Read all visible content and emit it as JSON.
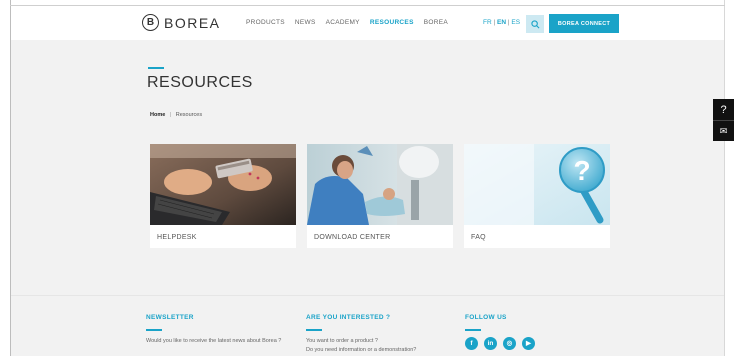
{
  "header": {
    "logo_mark": "B",
    "logo_text": "BOREA",
    "nav": [
      "PRODUCTS",
      "NEWS",
      "ACADEMY",
      "RESOURCES",
      "BOREA"
    ],
    "active_nav": "RESOURCES",
    "languages": {
      "fr": "FR",
      "en": "EN",
      "es": "ES",
      "sep": "|"
    },
    "current_language": "EN",
    "search_icon": "search-icon",
    "connect_label": "BOREA CONNECT"
  },
  "page": {
    "title": "RESOURCES",
    "breadcrumb": {
      "home": "Home",
      "sep": "|",
      "current": "Resources"
    }
  },
  "cards": [
    {
      "label": "HELPDESK",
      "image": "hands-laptop-credit-card-photo"
    },
    {
      "label": "DOWNLOAD CENTER",
      "image": "dentist-patient-photo"
    },
    {
      "label": "FAQ",
      "image": "question-mark-bubble-illustration"
    }
  ],
  "side_tools": {
    "help_icon": "?",
    "mail_icon": "✉"
  },
  "footer": {
    "newsletter": {
      "title": "NEWSLETTER",
      "text": "Would you like to receive the latest news about Borea ?"
    },
    "interested": {
      "title": "ARE YOU INTERESTED ?",
      "line1": "You want to order a product ?",
      "line2": "Do you need information or a demonstration?"
    },
    "follow": {
      "title": "FOLLOW US",
      "networks": [
        "f",
        "in",
        "◎",
        "▶"
      ]
    }
  },
  "colors": {
    "accent": "#1aa3c8",
    "background": "#f2f2f2",
    "text": "#333333"
  }
}
